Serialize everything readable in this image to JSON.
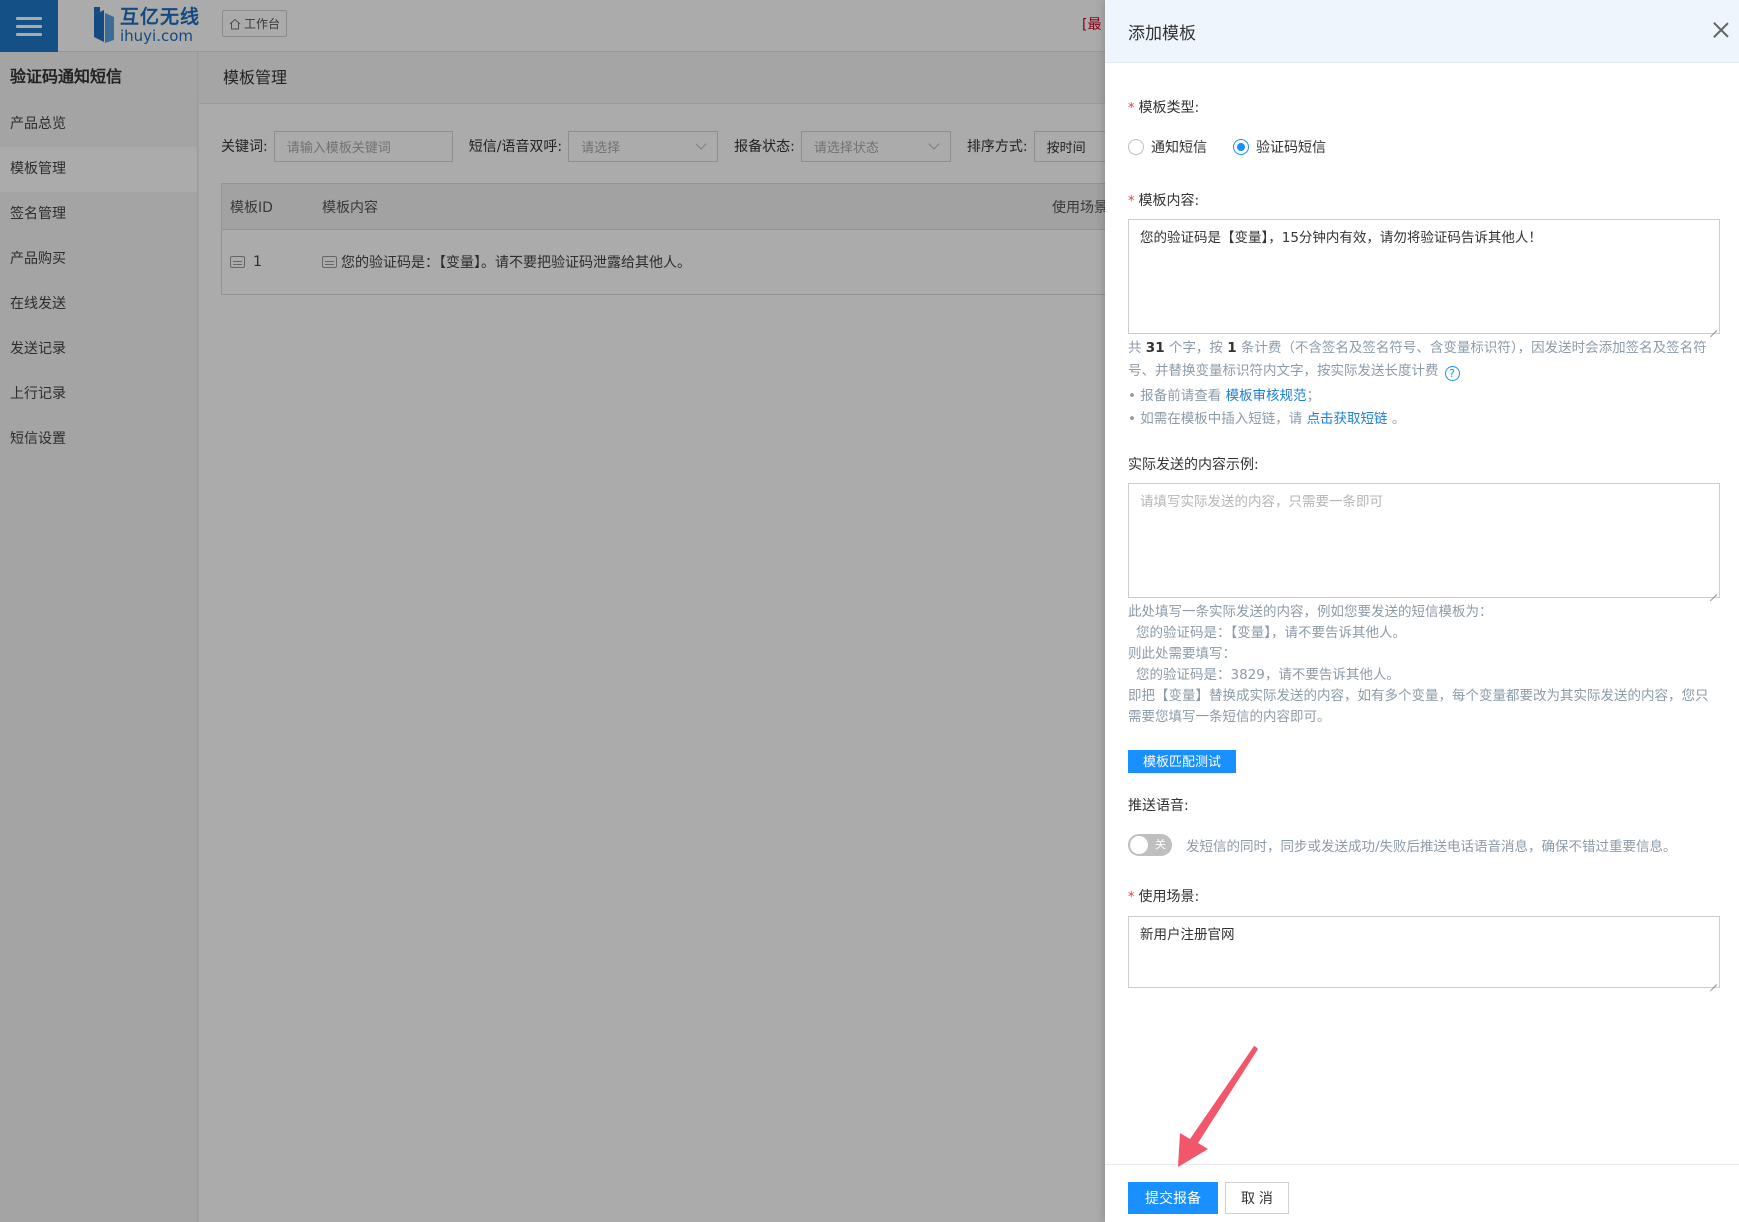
{
  "topbar": {
    "logo_cn": "互亿无线",
    "logo_en": "ihuyi.com",
    "workbench": "工作台",
    "notice_prefix": "[最"
  },
  "sidebar": {
    "title": "验证码通知短信",
    "items": [
      "产品总览",
      "模板管理",
      "签名管理",
      "产品购买",
      "在线发送",
      "发送记录",
      "上行记录",
      "短信设置"
    ]
  },
  "main": {
    "title": "模板管理",
    "filters": {
      "keyword_label": "关键词:",
      "keyword_placeholder": "请输入模板关键词",
      "type_label": "短信/语音双呼:",
      "type_placeholder": "请选择",
      "status_label": "报备状态:",
      "status_placeholder": "请选择状态",
      "sort_label": "排序方式:",
      "sort_value": "按时间"
    },
    "table": {
      "headers": [
        "模板ID",
        "模板内容",
        "使用场景"
      ],
      "rows": [
        {
          "id": "1",
          "content": "您的验证码是：【变量】。请不要把验证码泄露给其他人。"
        }
      ]
    }
  },
  "drawer": {
    "title": "添加模板",
    "type_label": "模板类型:",
    "type_options": [
      "通知短信",
      "验证码短信"
    ],
    "type_selected": "验证码短信",
    "content_label": "模板内容:",
    "content_value": "您的验证码是【变量】，15分钟内有效，请勿将验证码告诉其他人！",
    "count_hint": {
      "p1": "共",
      "chars": "31",
      "p2": "个字，按",
      "units": "1",
      "p3": "条计费（不含签名及签名符号、含变量标识符），因发送时会添加签名及签名符号、并替换变量标识符内文字，按实际发送长度计费"
    },
    "review_prefix": "• 报备前请查看",
    "review_link": "模板审核规范",
    "review_suffix": "；",
    "shortlink_prefix": "• 如需在模板中插入短链，请",
    "shortlink_link": "点击获取短链",
    "shortlink_suffix": "。",
    "example_label": "实际发送的内容示例:",
    "example_placeholder": "请填写实际发送的内容，只需要一条即可",
    "example_help": [
      "此处填写一条实际发送的内容，例如您要发送的短信模板为：",
      "您的验证码是：【变量】，请不要告诉其他人。",
      "则此处需要填写：",
      "您的验证码是：3829，请不要告诉其他人。",
      "即把【变量】替换成实际发送的内容，如有多个变量，每个变量都要改为其实际发送的内容，您只需要您填写一条短信的内容即可。"
    ],
    "test_button": "模板匹配测试",
    "voice_label": "推送语音:",
    "voice_switch_text": "关",
    "voice_desc": "发短信的同时，同步或发送成功/失败后推送电话语音消息，确保不错过重要信息。",
    "scene_label": "使用场景:",
    "scene_value": "新用户注册官网",
    "submit_button": "提交报备",
    "cancel_button": "取 消"
  },
  "colors": {
    "primary": "#1890ff",
    "brand": "#1e78c8",
    "required": "#e4393c",
    "arrow": "#f2566b"
  }
}
